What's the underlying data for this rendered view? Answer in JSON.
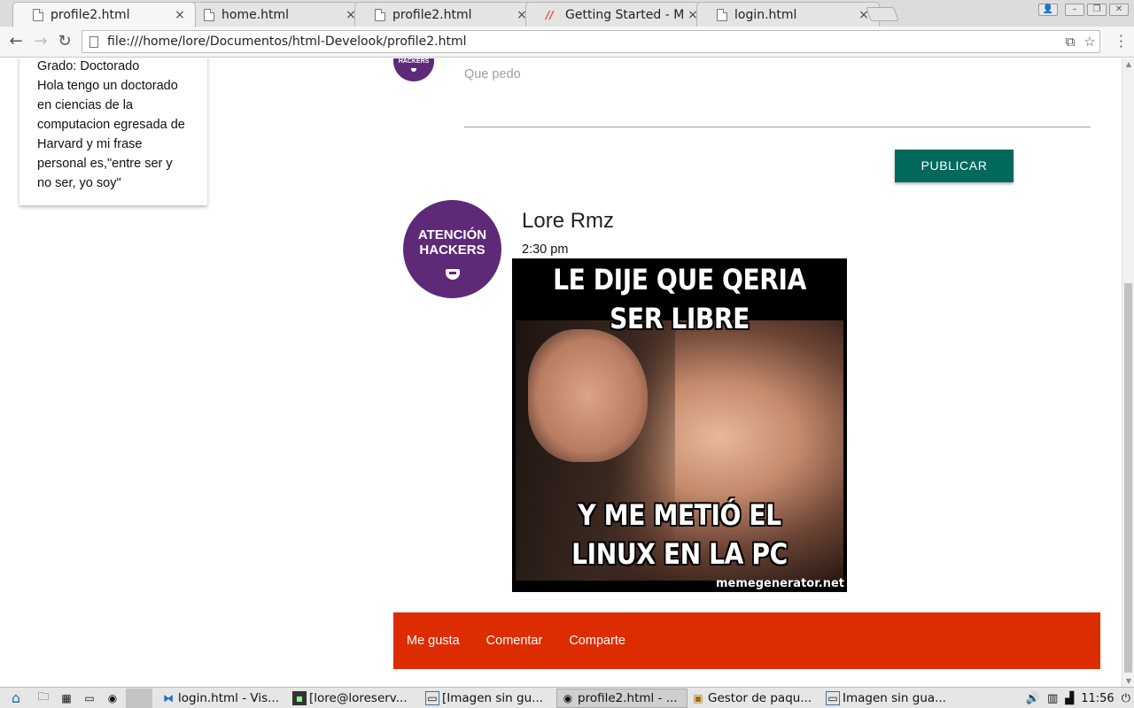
{
  "browser": {
    "tabs": [
      {
        "title": "profile2.html",
        "active": true,
        "icon": "page-icon"
      },
      {
        "title": "home.html",
        "active": false,
        "icon": "page-icon"
      },
      {
        "title": "profile2.html",
        "active": false,
        "icon": "page-icon"
      },
      {
        "title": "Getting Started - M",
        "active": false,
        "icon": "materialize-icon"
      },
      {
        "title": "login.html",
        "active": false,
        "icon": "page-icon"
      }
    ],
    "close_glyph": "×",
    "url": "file:///home/lore/Documentos/html-Develook/profile2.html"
  },
  "profile_card": {
    "grade_line": "Grado: Doctorado",
    "bio": "Hola tengo un doctorado en ciencias de la computacion egresada de Harvard y mi frase personal es,\"entre ser y no ser, yo soy\""
  },
  "composer": {
    "avatar_text": "HACKERS",
    "text": "Que pedo",
    "publish_label": "PUBLICAR"
  },
  "post": {
    "avatar_line1": "ATENCIÓN",
    "avatar_line2": "HACKERS",
    "author": "Lore Rmz",
    "time": "2:30 pm",
    "meme_top": "LE DIJE QUE QERIA SER LIBRE",
    "meme_bottom": "Y ME METIÓ EL LINUX EN LA PC",
    "meme_watermark": "memegenerator.net",
    "actions": [
      "Me gusta",
      "Comentar",
      "Comparte"
    ]
  },
  "taskbar": {
    "tasks": [
      {
        "label": "login.html - Vis...",
        "icon": "vscode-icon",
        "active": false
      },
      {
        "label": "[lore@loreserv...",
        "icon": "terminal-icon",
        "active": false
      },
      {
        "label": "[Imagen sin gu...",
        "icon": "window-icon",
        "active": false
      },
      {
        "label": "profile2.html - ...",
        "icon": "chrome-icon",
        "active": true
      },
      {
        "label": "Gestor de paqu...",
        "icon": "package-icon",
        "active": false
      },
      {
        "label": "Imagen sin gua...",
        "icon": "window-icon",
        "active": false
      }
    ],
    "clock": "11:56"
  },
  "colors": {
    "publish_button": "#00695c",
    "action_bar": "#dd2c00",
    "avatar": "#5e2a78"
  }
}
